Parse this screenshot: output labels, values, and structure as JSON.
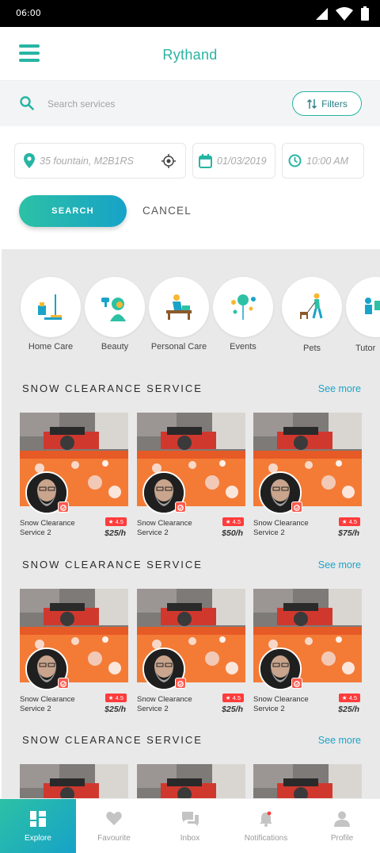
{
  "status_bar": {
    "time": "06:00"
  },
  "header": {
    "title": "Rythand"
  },
  "search": {
    "placeholder": "Search services",
    "filters_label": "Filters"
  },
  "fields": {
    "location": "35 fountain, M2B1RS",
    "date": "01/03/2019",
    "time": "10:00 AM"
  },
  "actions": {
    "search_label": "SEARCH",
    "cancel_label": "CANCEL"
  },
  "categories": [
    {
      "label": "Home Care",
      "icon": "cleaning-icon"
    },
    {
      "label": "Beauty",
      "icon": "hair-dryer-icon"
    },
    {
      "label": "Personal Care",
      "icon": "massage-icon"
    },
    {
      "label": "Events",
      "icon": "balloons-icon"
    },
    {
      "label": "Pets",
      "icon": "dog-walking-icon"
    },
    {
      "label": "Tutor",
      "icon": "tutor-icon"
    }
  ],
  "sections": [
    {
      "title": "SNOW CLEARANCE SERVICE",
      "see_more": "See more",
      "cards": [
        {
          "name_line1": "Snow Clearance",
          "name_line2": "Service 2",
          "rating": "4.5",
          "price": "$25/h"
        },
        {
          "name_line1": "Snow Clearance",
          "name_line2": "Service 2",
          "rating": "4.5",
          "price": "$50/h"
        },
        {
          "name_line1": "Snow Clearance",
          "name_line2": "Service 2",
          "rating": "4.5",
          "price": "$75/h"
        }
      ]
    },
    {
      "title": "SNOW CLEARANCE SERVICE",
      "see_more": "See more",
      "cards": [
        {
          "name_line1": "Snow Clearance",
          "name_line2": "Service 2",
          "rating": "4.5",
          "price": "$25/h"
        },
        {
          "name_line1": "Snow Clearance",
          "name_line2": "Service 2",
          "rating": "4.5",
          "price": "$25/h"
        },
        {
          "name_line1": "Snow Clearance",
          "name_line2": "Service 2",
          "rating": "4.5",
          "price": "$25/h"
        }
      ]
    },
    {
      "title": "SNOW CLEARANCE SERVICE",
      "see_more": "See more",
      "cards": []
    }
  ],
  "bottom_nav": [
    {
      "label": "Explore",
      "icon": "grid-icon",
      "active": true
    },
    {
      "label": "Favourite",
      "icon": "heart-icon",
      "active": false
    },
    {
      "label": "Inbox",
      "icon": "chat-icon",
      "active": false
    },
    {
      "label": "Notifications",
      "icon": "bell-icon",
      "active": false
    },
    {
      "label": "Profile",
      "icon": "person-icon",
      "active": false
    }
  ],
  "colors": {
    "accent": "#26b5a3",
    "accent_blue": "#17a2c8",
    "rating_red": "#ff3b3b",
    "link": "#1ea3c8"
  }
}
